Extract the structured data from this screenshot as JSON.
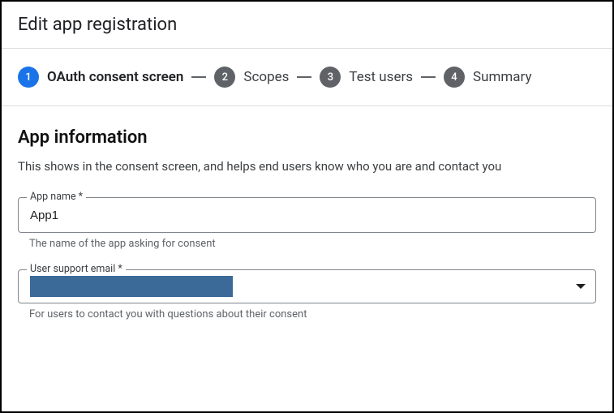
{
  "header": {
    "title": "Edit app registration"
  },
  "stepper": {
    "steps": [
      {
        "num": "1",
        "label": "OAuth consent screen",
        "active": true
      },
      {
        "num": "2",
        "label": "Scopes",
        "active": false
      },
      {
        "num": "3",
        "label": "Test users",
        "active": false
      },
      {
        "num": "4",
        "label": "Summary",
        "active": false
      }
    ]
  },
  "section": {
    "title": "App information",
    "desc": "This shows in the consent screen, and helps end users know who you are and contact you"
  },
  "fields": {
    "app_name": {
      "label": "App name *",
      "value": "App1",
      "helper": "The name of the app asking for consent"
    },
    "support_email": {
      "label": "User support email *",
      "value": "",
      "helper": "For users to contact you with questions about their consent"
    }
  }
}
